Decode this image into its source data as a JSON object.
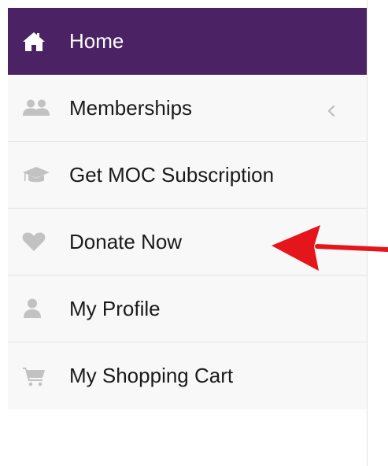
{
  "sidebar": {
    "items": [
      {
        "label": "Home",
        "icon": "home-icon",
        "active": true
      },
      {
        "label": "Memberships",
        "icon": "users-icon",
        "active": false
      },
      {
        "label": "Get MOC Subscription",
        "icon": "graduation-cap-icon",
        "active": false
      },
      {
        "label": "Donate Now",
        "icon": "heart-icon",
        "active": false
      },
      {
        "label": "My Profile",
        "icon": "user-icon",
        "active": false
      },
      {
        "label": "My Shopping Cart",
        "icon": "shopping-cart-icon",
        "active": false
      }
    ]
  },
  "colors": {
    "active_bg": "#4b2364",
    "sidebar_bg": "#f8f8f8",
    "icon_gray": "#c2c2c2",
    "annotation_arrow": "#e4161b"
  }
}
